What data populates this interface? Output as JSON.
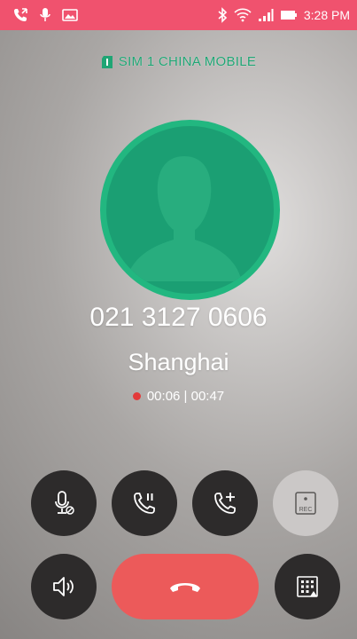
{
  "status_bar": {
    "time": "3:28 PM",
    "background": "#f0526e",
    "left_icons": [
      "call-status-icon",
      "microphone-icon",
      "image-icon"
    ],
    "right_icons": [
      "bluetooth-icon",
      "wifi-icon",
      "signal-icon",
      "battery-icon"
    ]
  },
  "call": {
    "sim_label": "SIM 1  CHINA MOBILE",
    "sim_color": "#1fa574",
    "number": "021 3127 0606",
    "location": "Shanghai",
    "elapsed": "00:06 | 00:47",
    "avatar_color": "#22b780"
  },
  "controls": {
    "row1": [
      "mute-icon",
      "hold-icon",
      "add-call-icon",
      "record-icon"
    ],
    "record_label": "REC",
    "row2": [
      "speaker-icon",
      "end-call-icon",
      "dialpad-icon"
    ],
    "end_call_color": "#ec5a5a"
  }
}
